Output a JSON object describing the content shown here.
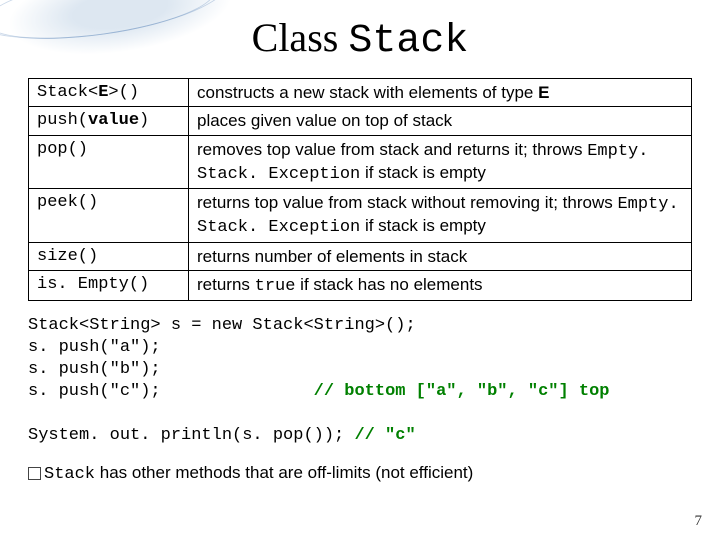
{
  "title": {
    "prefix": "Class ",
    "mono": "Stack"
  },
  "table": {
    "rows": [
      {
        "method_pre": "Stack<",
        "method_b": "E",
        "method_post": ">()",
        "desc_pre": "constructs a new stack with elements of type ",
        "desc_b": "E",
        "desc_post": ""
      },
      {
        "method_pre": "push(",
        "method_b": "value",
        "method_post": ")",
        "desc_pre": "places given value on top of stack",
        "desc_b": "",
        "desc_post": ""
      },
      {
        "method_pre": "pop()",
        "method_b": "",
        "method_post": "",
        "desc_pre": "removes top value from stack and returns it; throws ",
        "desc_mono": "Empty. Stack. Exception",
        "desc_post2": " if stack is empty"
      },
      {
        "method_pre": "peek()",
        "method_b": "",
        "method_post": "",
        "desc_pre": "returns top value from stack without removing it; throws ",
        "desc_mono": "Empty. Stack. Exception",
        "desc_post2": " if stack is empty"
      },
      {
        "method_pre": "size()",
        "method_b": "",
        "method_post": "",
        "desc_pre": "returns number of elements in stack",
        "desc_b": "",
        "desc_post": ""
      },
      {
        "method_pre": "is. Empty()",
        "method_b": "",
        "method_post": "",
        "desc_pre": "returns ",
        "desc_mono": "true",
        "desc_post2": " if stack has no elements"
      }
    ]
  },
  "code": {
    "l1": "Stack<String> s = new Stack<String>();",
    "l2": "s. push(\"a\");",
    "l3": "s. push(\"b\");",
    "l4a": "s. push(\"c\");               ",
    "l4b": "// bottom [\"a\", \"b\", \"c\"] top",
    "l5a": "System. out. println(s. pop()); ",
    "l5b": "// \"c\""
  },
  "note": {
    "mono": "Stack",
    "rest": " has other methods that are off-limits (not efficient)"
  },
  "page": "7"
}
